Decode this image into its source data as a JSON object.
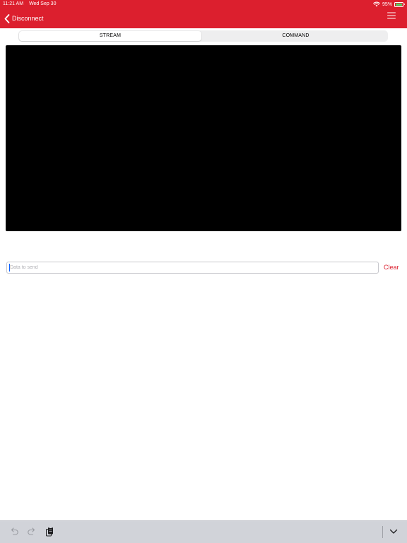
{
  "status_bar": {
    "time": "11:21 AM",
    "date": "Wed Sep 30",
    "battery_percent": "95%",
    "battery_level": 0.95,
    "wifi_icon": "wifi-icon",
    "battery_icon": "battery-icon"
  },
  "nav": {
    "back_label": "Disconnect",
    "back_icon": "chevron-left-icon",
    "menu_icon": "hamburger-menu-icon"
  },
  "tabs": [
    {
      "label": "STREAM",
      "selected": true
    },
    {
      "label": "COMMAND",
      "selected": false
    }
  ],
  "console": {
    "output": ""
  },
  "send": {
    "placeholder": "Data to send",
    "value": "",
    "clear_label": "Clear"
  },
  "keyboard_toolbar": {
    "icons": [
      "undo-icon",
      "redo-icon",
      "paste-icon",
      "dismiss-keyboard-icon"
    ]
  },
  "colors": {
    "accent": "#dc1f2e",
    "console_background": "#000000",
    "toolbar_background": "#d1d3d9"
  }
}
